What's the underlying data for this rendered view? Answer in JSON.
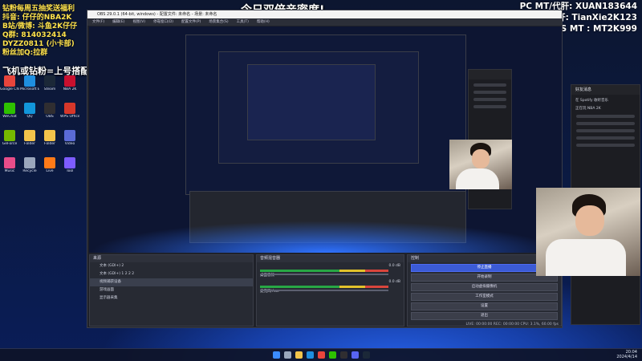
{
  "overlay": {
    "stream_title": "今日双倍亲密度!",
    "promo_line": "飞机或钻粉=上号搭配实战!",
    "promo_lines": [
      "钻粉每周五抽奖送福利",
      "抖音: 仔仔的NBA2K",
      "B站/微博: 斗鱼2K仔仔",
      "Q群: 814032414",
      "DYZZ0811 (小卡部)",
      "粉丝加Q:拉群"
    ],
    "pc_mt": "PC MT/代肝: XUAN183644",
    "ps_mt": "PS专业代肝: TianXie2K123",
    "ps_mt2": "PS MT : MT2K999"
  },
  "desktop_icons": [
    {
      "label": "Google Chrome",
      "color": "#e8453c"
    },
    {
      "label": "Microsoft Edge",
      "color": "#1f8fe0"
    },
    {
      "label": "Steam",
      "color": "#1b2838"
    },
    {
      "label": "NBA 2K",
      "color": "#c8102e"
    },
    {
      "label": "WeChat",
      "color": "#2ec100"
    },
    {
      "label": "QQ",
      "color": "#1296db"
    },
    {
      "label": "OBS",
      "color": "#302e31"
    },
    {
      "label": "WPS Office",
      "color": "#d6372a"
    },
    {
      "label": "GeForce",
      "color": "#76b900"
    },
    {
      "label": "Folder",
      "color": "#f3c44b"
    },
    {
      "label": "Folder",
      "color": "#f3c44b"
    },
    {
      "label": "Video",
      "color": "#5b6bd6"
    },
    {
      "label": "Music",
      "color": "#e84d8a"
    },
    {
      "label": "Recycle",
      "color": "#9aa7bd"
    },
    {
      "label": "Live",
      "color": "#ff7a18"
    },
    {
      "label": "Tool",
      "color": "#7d5cff"
    }
  ],
  "obs": {
    "window_title": "OBS 29.0.1 (64-bit, windows) - 配置文件: 未命名 - 场景: 未命名",
    "menu": [
      "文件(F)",
      "编辑(E)",
      "视图(V)",
      "停靠窗口(D)",
      "配置文件(P)",
      "场景集合(S)",
      "工具(T)",
      "帮助(H)"
    ],
    "scene_tabs": [
      "场景",
      "来源"
    ],
    "sources_title": "来源",
    "sources": [
      "文本 (GDI+) 2",
      "文本 (GDI+) 1 2 2 2",
      "视频捕获设备",
      "游戏画面",
      "显示器采集"
    ],
    "mixer_title": "音频混音器",
    "mixer": [
      {
        "label": "桌面音频",
        "db": "0.0 dB"
      },
      {
        "label": "麦克风/Aux",
        "db": "0.0 dB"
      }
    ],
    "controls_title": "控制",
    "controls": [
      "停止直播",
      "开始录制",
      "启动虚拟摄像机",
      "工作室模式",
      "设置",
      "退出"
    ],
    "status": "LIVE: 00:00:00   REC: 00:00:00   CPU: 3.1%, 60.00 fps"
  },
  "chat": {
    "title": "好友消息",
    "line1": "在 Spotify 收听音乐",
    "line2": "正在玩 NBA 2K"
  },
  "clock": {
    "time": "20:04",
    "date": "2024/4/14"
  }
}
